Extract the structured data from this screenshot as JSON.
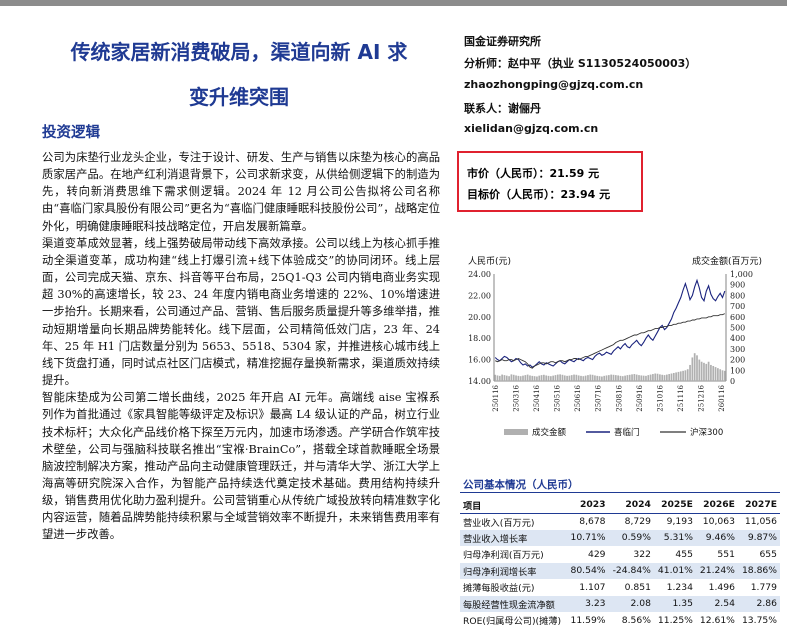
{
  "title_line1": "传统家居新消费破局，渠道向新 AI 求",
  "title_line2": "变升维突围",
  "section_heading": "投资逻辑",
  "paragraphs": [
    "公司为床垫行业龙头企业，专注于设计、研发、生产与销售以床垫为核心的高品质家居产品。在地产红利消退背景下，公司求新求变，从供给侧逻辑下的制造为先，转向新消费思维下需求侧逻辑。2024 年 12 月公司公告拟将公司名称由“喜临门家具股份有限公司”更名为“喜临门健康睡眠科技股份公司”，战略定位外化，明确健康睡眠科技战略定位，开启发展新篇章。",
    "渠道变革成效显著，线上强势破局带动线下高效承接。公司以线上为核心抓手推动全渠道变革，成功构建“线上打爆引流+线下体验成交”的协同闭环。线上层面，公司完成天猫、京东、抖音等平台布局，25Q1-Q3 公司内销电商业务实现超 30%的高速增长，较 23、24 年度内销电商业务增速的 22%、10%增速进一步抬升。长期来看，公司通过产品、营销、售后服务质量提升等多维举措，推动短期增量向长期品牌势能转化。线下层面，公司精简低效门店，23 年、24 年、25 年 H1 门店数量分别为 5653、5518、5304 家，并推进核心城市线上线下货盘打通，同时试点社区门店模式，精准挖掘存量换新需求，渠道质效持续提升。",
    "智能床垫成为公司第二增长曲线，2025 年开启 AI 元年。高端线 aise 宝褓系列作为首批通过《家具智能等级评定及标识》最高 L4 级认证的产品，树立行业技术标杆；大众化产品线价格下探至万元内，加速市场渗透。产学研合作筑牢技术壁垒，公司与强脑科技联名推出“宝褓·BrainCo”，搭载全球首款睡眠全场景脑波控制解决方案，推动产品向主动健康管理跃迁，并与清华大学、浙江大学上海高等研究院深入合作，为智能产品持续迭代奠定技术基础。费用结构持续升级，销售费用优化助力盈利提升。公司营销重心从传统广域投放转向精准数字化内容运营，随着品牌势能持续积累与全域营销效率不断提升，未来销售费用率有望进一步改善。"
  ],
  "research_info": {
    "institute": "国金证券研究所",
    "analyst": "分析师：赵中平（执业 S1130524050003）",
    "analyst_email": "zhaozhongping@gjzq.com.cn",
    "contact": "联系人：谢俪丹",
    "contact_email": "xielidan@gjzq.com.cn"
  },
  "price_box": {
    "market_price": "市价（人民币）：21.59 元",
    "target_price": "目标价（人民币）：23.94 元",
    "border_color": "#e0212f"
  },
  "chart_data": {
    "type": "line",
    "left_axis_label": "人民币(元)",
    "right_axis_label": "成交金额(百万元)",
    "left_ylim": [
      14,
      24
    ],
    "left_ticks": [
      "14.00",
      "16.00",
      "18.00",
      "20.00",
      "22.00",
      "24.00"
    ],
    "right_ylim": [
      0,
      1000
    ],
    "right_ticks": [
      "0",
      "100",
      "200",
      "300",
      "400",
      "500",
      "600",
      "700",
      "800",
      "900",
      "1,000"
    ],
    "x_ticks": [
      "250116",
      "250316",
      "250416",
      "250516",
      "250616",
      "250716",
      "250816",
      "250916",
      "251016",
      "251116",
      "251216",
      "260116"
    ],
    "series": [
      {
        "name": "成交金额",
        "kind": "bar",
        "axis": "right",
        "color": "#b0b0b0",
        "values": [
          58,
          52,
          48,
          60,
          55,
          50,
          45,
          62,
          58,
          52,
          48,
          45,
          50,
          55,
          60,
          52,
          48,
          45,
          42,
          50,
          55,
          58,
          52,
          48,
          45,
          50,
          55,
          60,
          62,
          58,
          52,
          48,
          50,
          55,
          60,
          58,
          52,
          48,
          45,
          50,
          55,
          60,
          58,
          52,
          48,
          45,
          42,
          48,
          52,
          55,
          60,
          58,
          55,
          52,
          48,
          45,
          50,
          55,
          58,
          62,
          65,
          60,
          55,
          52,
          50,
          48,
          55,
          60,
          65,
          70,
          68,
          62,
          58,
          55,
          60,
          65,
          70,
          75,
          80,
          85,
          90,
          95,
          100,
          110,
          150,
          220,
          260,
          240,
          200,
          180,
          170,
          160,
          180,
          150,
          140,
          130,
          120,
          110,
          100,
          95
        ]
      },
      {
        "name": "喜临门",
        "kind": "line",
        "axis": "left",
        "color": "#1a237e",
        "values": [
          16.2,
          16.0,
          15.9,
          16.1,
          16.3,
          16.2,
          16.0,
          15.8,
          15.9,
          16.1,
          16.0,
          15.7,
          15.5,
          15.6,
          15.4,
          15.5,
          15.3,
          15.4,
          15.6,
          15.8,
          15.6,
          15.5,
          15.7,
          15.6,
          15.5,
          15.4,
          15.6,
          15.8,
          15.9,
          15.7,
          15.6,
          15.8,
          16.0,
          15.9,
          15.8,
          16.0,
          16.1,
          16.0,
          15.9,
          16.1,
          16.2,
          16.1,
          16.0,
          16.3,
          16.5,
          16.6,
          16.4,
          16.5,
          16.7,
          16.6,
          16.5,
          16.8,
          17.0,
          17.2,
          17.0,
          17.3,
          17.5,
          17.2,
          17.1,
          17.4,
          17.6,
          17.8,
          17.5,
          17.3,
          17.6,
          18.0,
          18.3,
          18.0,
          17.8,
          18.2,
          18.6,
          19.0,
          19.2,
          18.8,
          19.0,
          19.4,
          19.8,
          20.4,
          20.8,
          21.3,
          21.8,
          22.5,
          23.1,
          22.4,
          21.6,
          22.0,
          22.8,
          23.4,
          22.7,
          21.8,
          21.5,
          22.4,
          22.9,
          22.1,
          21.7,
          21.5,
          21.9,
          22.2,
          21.8,
          22.4
        ]
      },
      {
        "name": "沪深300",
        "kind": "line",
        "axis": "left",
        "color": "#333333",
        "values": [
          15.9,
          15.8,
          15.9,
          16.0,
          15.9,
          15.9,
          16.0,
          16.0,
          15.9,
          16.0,
          16.1,
          16.0,
          15.9,
          15.8,
          15.6,
          15.3,
          15.2,
          15.4,
          15.5,
          15.6,
          15.7,
          15.7,
          15.6,
          15.7,
          15.8,
          15.8,
          15.7,
          15.8,
          15.9,
          15.9,
          15.8,
          15.9,
          16.0,
          16.0,
          16.1,
          16.1,
          16.0,
          16.1,
          16.2,
          16.3,
          16.3,
          16.4,
          16.5,
          16.6,
          16.7,
          16.8,
          16.9,
          17.0,
          17.1,
          17.2,
          17.3,
          17.4,
          17.6,
          17.7,
          17.8,
          17.8,
          17.9,
          18.0,
          18.1,
          18.2,
          18.3,
          18.3,
          18.4,
          18.5,
          18.5,
          18.6,
          18.7,
          18.7,
          18.8,
          18.9,
          18.9,
          19.0,
          19.0,
          19.1,
          19.1,
          19.2,
          19.2,
          19.3,
          19.3,
          19.4,
          19.4,
          19.5,
          19.5,
          19.6,
          19.6,
          19.7,
          19.7,
          19.8,
          19.8,
          19.9,
          19.9,
          19.9,
          20.0,
          20.0,
          20.1,
          20.1,
          20.1,
          20.2,
          20.2,
          20.3
        ]
      }
    ],
    "legend": [
      "成交金额",
      "喜临门",
      "沪深300"
    ],
    "legend_position": "bottom"
  },
  "table": {
    "title": "公司基本情况（人民币）",
    "headers": [
      "项目",
      "2023",
      "2024",
      "2025E",
      "2026E",
      "2027E"
    ],
    "rows": [
      [
        "营业收入(百万元)",
        "8,678",
        "8,729",
        "9,193",
        "10,063",
        "11,056"
      ],
      [
        "营业收入增长率",
        "10.71%",
        "0.59%",
        "5.31%",
        "9.46%",
        "9.87%"
      ],
      [
        "归母净利润(百万元)",
        "429",
        "322",
        "455",
        "551",
        "655"
      ],
      [
        "归母净利润增长率",
        "80.54%",
        "-24.84%",
        "41.01%",
        "21.24%",
        "18.86%"
      ],
      [
        "摊薄每股收益(元)",
        "1.107",
        "0.851",
        "1.234",
        "1.496",
        "1.779"
      ],
      [
        "每股经营性现金流净额",
        "3.23",
        "2.08",
        "1.35",
        "2.54",
        "2.86"
      ],
      [
        "ROE(归属母公司)(摊薄)",
        "11.59%",
        "8.56%",
        "11.25%",
        "12.61%",
        "13.75%"
      ]
    ]
  },
  "colors": {
    "title_blue": "#1f3a93",
    "stock_line": "#1a237e",
    "index_line": "#333333",
    "row_shade": "#dde6f3"
  }
}
